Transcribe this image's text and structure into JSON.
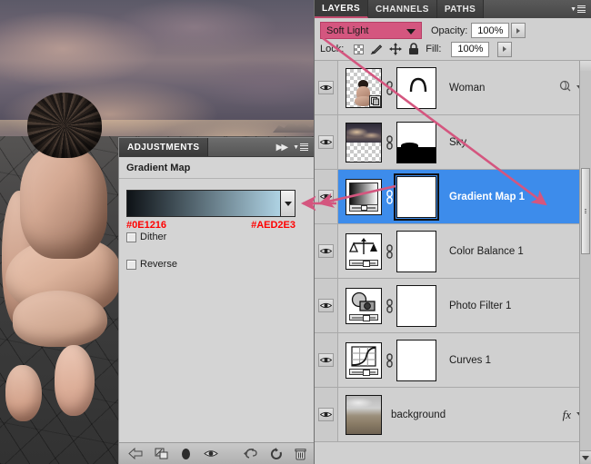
{
  "adjustments": {
    "tab_label": "ADJUSTMENTS",
    "title": "Gradient Map",
    "collapse_icon": "double-chevron-right-icon",
    "menu_icon": "panel-menu-icon",
    "gradient": {
      "start_hex": "#0E1216",
      "end_hex": "#AED2E3",
      "start_label": "#0E1216",
      "end_label": "#AED2E3",
      "dropdown_icon": "chevron-down-icon"
    },
    "dither": {
      "label": "Dither",
      "checked": false
    },
    "reverse": {
      "label": "Reverse",
      "checked": false
    },
    "footer_icons": [
      "back-arrow-icon",
      "clip-to-layer-icon",
      "mask-toggle-icon",
      "preview-eye-icon",
      "previous-state-icon",
      "reset-icon",
      "delete-icon"
    ]
  },
  "layers_panel": {
    "tabs": [
      {
        "label": "LAYERS",
        "active": true
      },
      {
        "label": "CHANNELS",
        "active": false
      },
      {
        "label": "PATHS",
        "active": false
      }
    ],
    "menu_icon": "panel-menu-icon",
    "blend_mode": {
      "value": "Soft Light",
      "highlight_color": "#D4567F",
      "caret_icon": "chevron-down-icon"
    },
    "opacity": {
      "label": "Opacity:",
      "value": "100%"
    },
    "fill": {
      "label": "Fill:",
      "value": "100%"
    },
    "lock": {
      "label": "Lock:",
      "icons": [
        "lock-transparency-icon",
        "lock-image-pixels-icon",
        "lock-position-icon",
        "lock-all-icon"
      ]
    },
    "layers": [
      {
        "name": "Woman",
        "visible": true,
        "selected": false,
        "thumb_type": "photo-transparent",
        "has_smart_badge": true,
        "has_link": true,
        "has_mask": true,
        "mask_type": "arc",
        "right_icons": [
          "layer-style-sphere-icon",
          "expand-chevron-icon"
        ]
      },
      {
        "name": "Sky",
        "visible": true,
        "selected": false,
        "thumb_type": "sky-photo-half",
        "has_smart_badge": false,
        "has_link": true,
        "has_mask": true,
        "mask_type": "horizon",
        "right_icons": []
      },
      {
        "name": "Gradient Map 1",
        "visible": true,
        "selected": true,
        "thumb_type": "gradient-map",
        "has_smart_badge": false,
        "has_link": true,
        "has_mask": true,
        "mask_type": "white",
        "right_icons": []
      },
      {
        "name": "Color Balance 1",
        "visible": true,
        "selected": false,
        "thumb_type": "color-balance",
        "has_smart_badge": false,
        "has_link": true,
        "has_mask": true,
        "mask_type": "white",
        "right_icons": []
      },
      {
        "name": "Photo Filter 1",
        "visible": true,
        "selected": false,
        "thumb_type": "photo-filter",
        "has_smart_badge": false,
        "has_link": true,
        "has_mask": true,
        "mask_type": "white",
        "right_icons": []
      },
      {
        "name": "Curves 1",
        "visible": true,
        "selected": false,
        "thumb_type": "curves",
        "has_smart_badge": false,
        "has_link": true,
        "has_mask": true,
        "mask_type": "white",
        "right_icons": []
      },
      {
        "name": "background",
        "visible": true,
        "selected": false,
        "thumb_type": "background-photo",
        "has_smart_badge": false,
        "has_link": false,
        "has_mask": false,
        "mask_type": "",
        "right_icons": [
          "fx-badge",
          "expand-chevron-icon"
        ],
        "fx_label": "fx"
      }
    ]
  },
  "annotations": {
    "color": "#D4567F",
    "arrow_to_gradient_swatch": "arrow-pointing-left-to-gradient-preset",
    "arrow_to_gradient_map_layer": "arrow-pointing-left-to-gradient-map-thumbnail",
    "arrow_from_blend_mode": "arrow-from-blend-mode-to-gradient-map-row"
  },
  "canvas": {
    "description": "composited photo of a crouching figure on cracked dark ground under a dramatic stormy sky"
  }
}
